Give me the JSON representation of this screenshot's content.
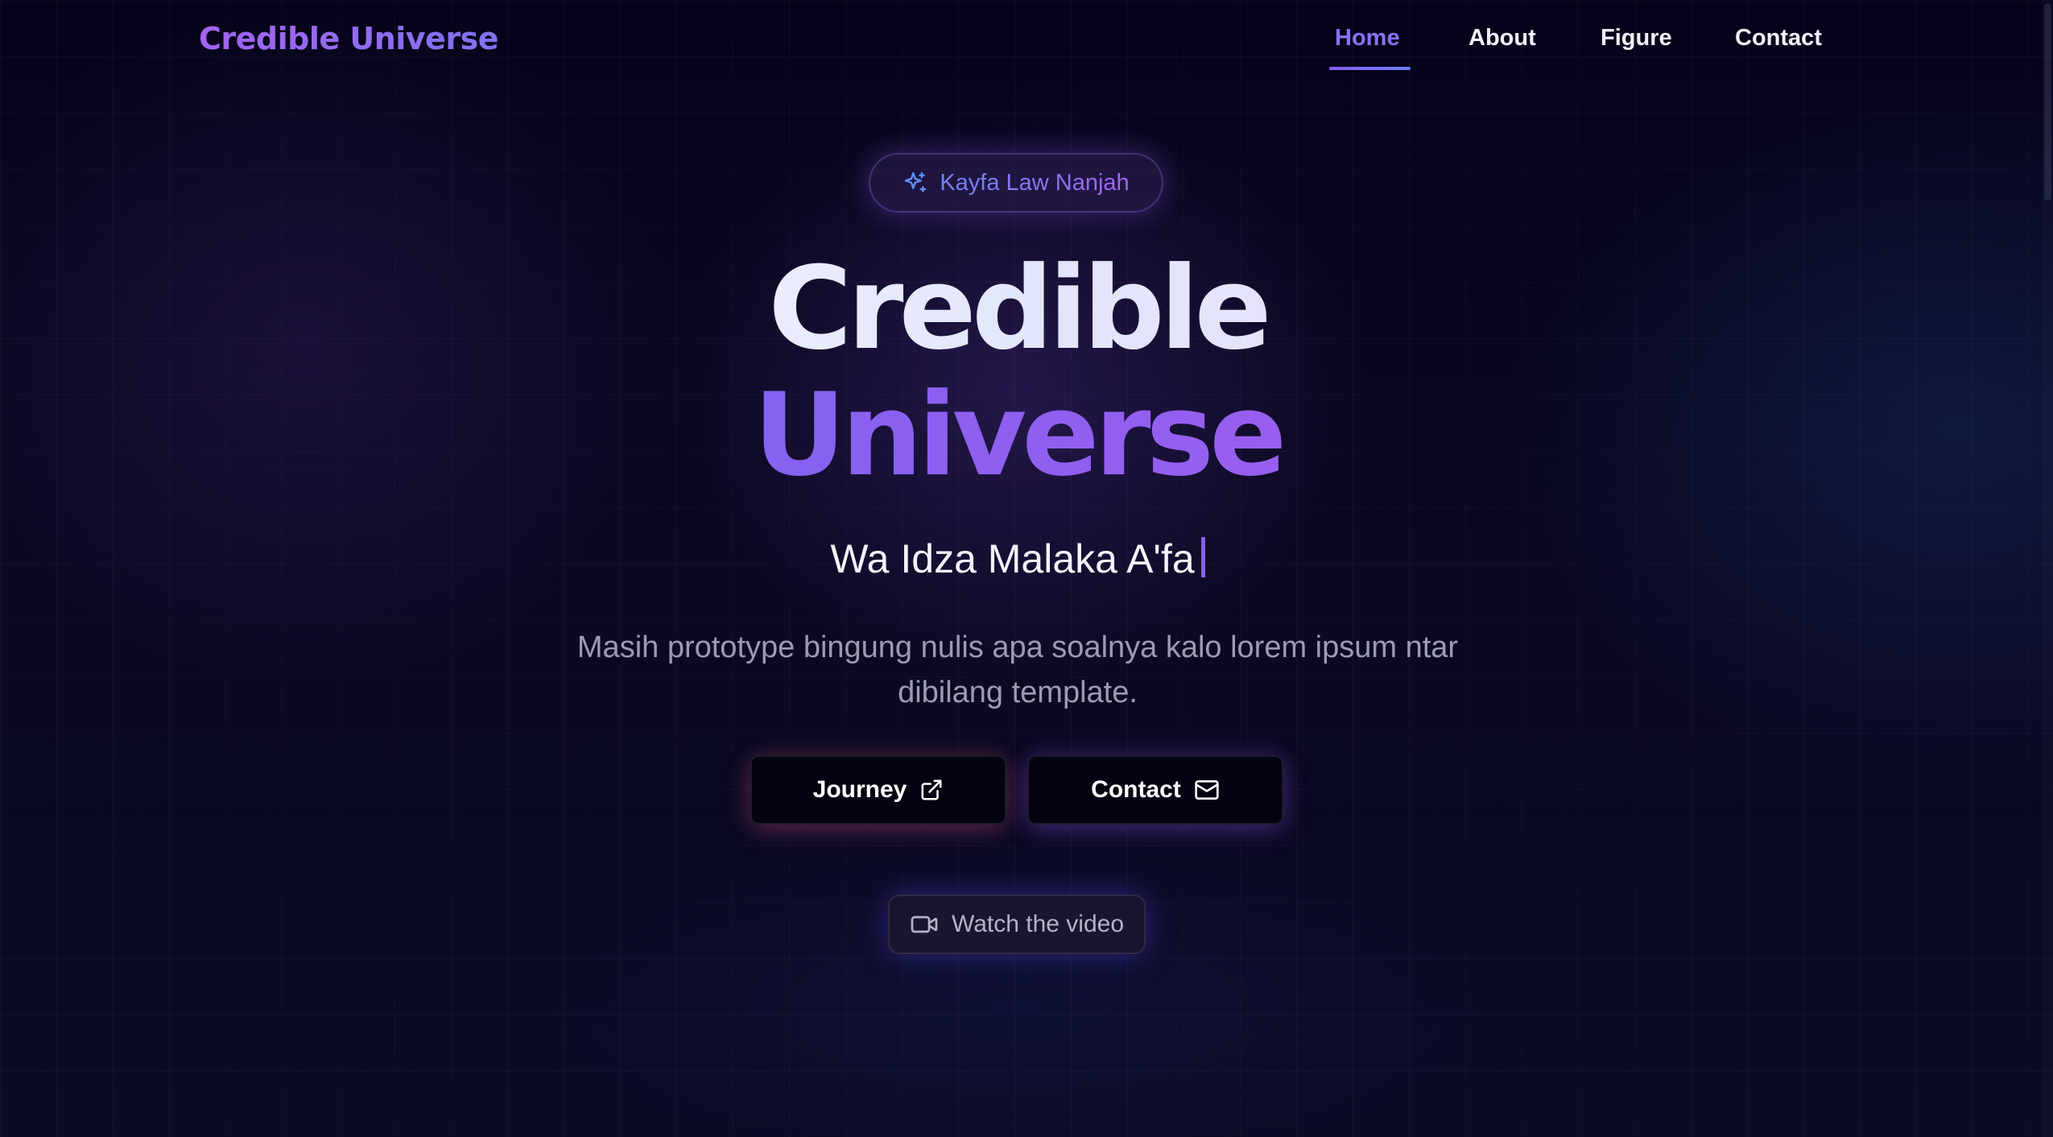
{
  "header": {
    "logo": "Credible Universe",
    "nav": [
      {
        "label": "Home",
        "active": true
      },
      {
        "label": "About",
        "active": false
      },
      {
        "label": "Figure",
        "active": false
      },
      {
        "label": "Contact",
        "active": false
      }
    ]
  },
  "hero": {
    "badge": {
      "icon": "sparkles-icon",
      "text": "Kayfa Law Nanjah"
    },
    "title_line1": "Credible",
    "title_line2": "Universe",
    "typed_text": "Wa Idza Malaka A'fa",
    "description": "Masih prototype bingung nulis apa soalnya kalo lorem ipsum ntar dibilang template.",
    "buttons": [
      {
        "label": "Journey",
        "icon": "external-link-icon"
      },
      {
        "label": "Contact",
        "icon": "mail-icon"
      }
    ],
    "video_button": {
      "label": "Watch the video",
      "icon": "video-camera-icon"
    }
  },
  "colors": {
    "accent": "#8b5cf6",
    "accent_blue": "#6a6af3",
    "background": "#07051a",
    "text": "#f4f2fb",
    "muted": "#9c9bb0"
  }
}
